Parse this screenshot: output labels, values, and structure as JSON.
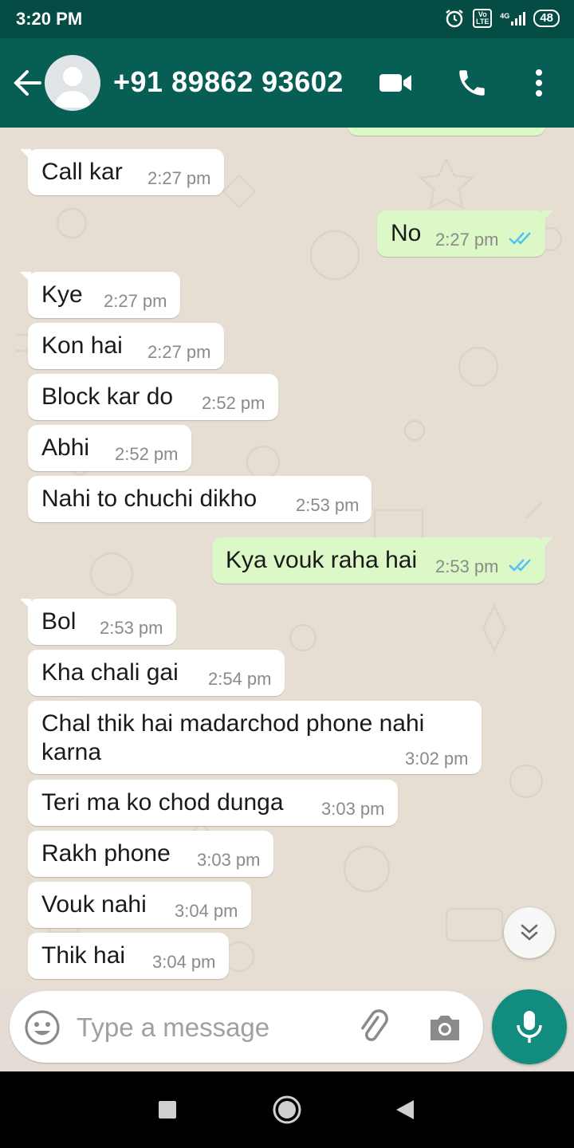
{
  "status_bar": {
    "time": "3:20 PM",
    "volte_label": "Vo LTE",
    "network": "4G",
    "battery": "48"
  },
  "header": {
    "contact": "+91 89862 93602",
    "icons": [
      "back-arrow-icon",
      "avatar",
      "video-call-icon",
      "phone-icon",
      "more-vert-icon"
    ]
  },
  "messages": [
    {
      "dir": "in",
      "text": "Call kar",
      "time": "2:27 pm"
    },
    {
      "dir": "out",
      "text": "No",
      "time": "2:27 pm"
    },
    {
      "dir": "in",
      "text": "Kye",
      "time": "2:27 pm"
    },
    {
      "dir": "in",
      "text": "Kon hai",
      "time": "2:27 pm"
    },
    {
      "dir": "in",
      "text": "Block kar do",
      "time": "2:52 pm"
    },
    {
      "dir": "in",
      "text": "Abhi",
      "time": "2:52 pm"
    },
    {
      "dir": "in",
      "text": "Nahi to chuchi dikho",
      "time": "2:53 pm"
    },
    {
      "dir": "out",
      "text": "Kya vouk raha hai",
      "time": "2:53 pm"
    },
    {
      "dir": "in",
      "text": "Bol",
      "time": "2:53 pm"
    },
    {
      "dir": "in",
      "text": "Kha chali gai",
      "time": "2:54 pm"
    },
    {
      "dir": "in",
      "text": "Chal thik hai madarchod phone nahi",
      "text2": "karna",
      "time": "3:02 pm"
    },
    {
      "dir": "in",
      "text": "Teri ma ko chod dunga",
      "time": "3:03 pm"
    },
    {
      "dir": "in",
      "text": "Rakh phone",
      "time": "3:03 pm"
    },
    {
      "dir": "in",
      "text": "Vouk nahi",
      "time": "3:04 pm"
    },
    {
      "dir": "in",
      "text": "Thik hai",
      "time": "3:04 pm"
    }
  ],
  "composer": {
    "placeholder": "Type a message"
  },
  "colors": {
    "header": "#075e54",
    "status_bar": "#054c44",
    "outgoing_bubble": "#dcf8c6",
    "incoming_bubble": "#ffffff",
    "mic_button": "#128c7e",
    "read_ticks": "#4fc3f7"
  }
}
